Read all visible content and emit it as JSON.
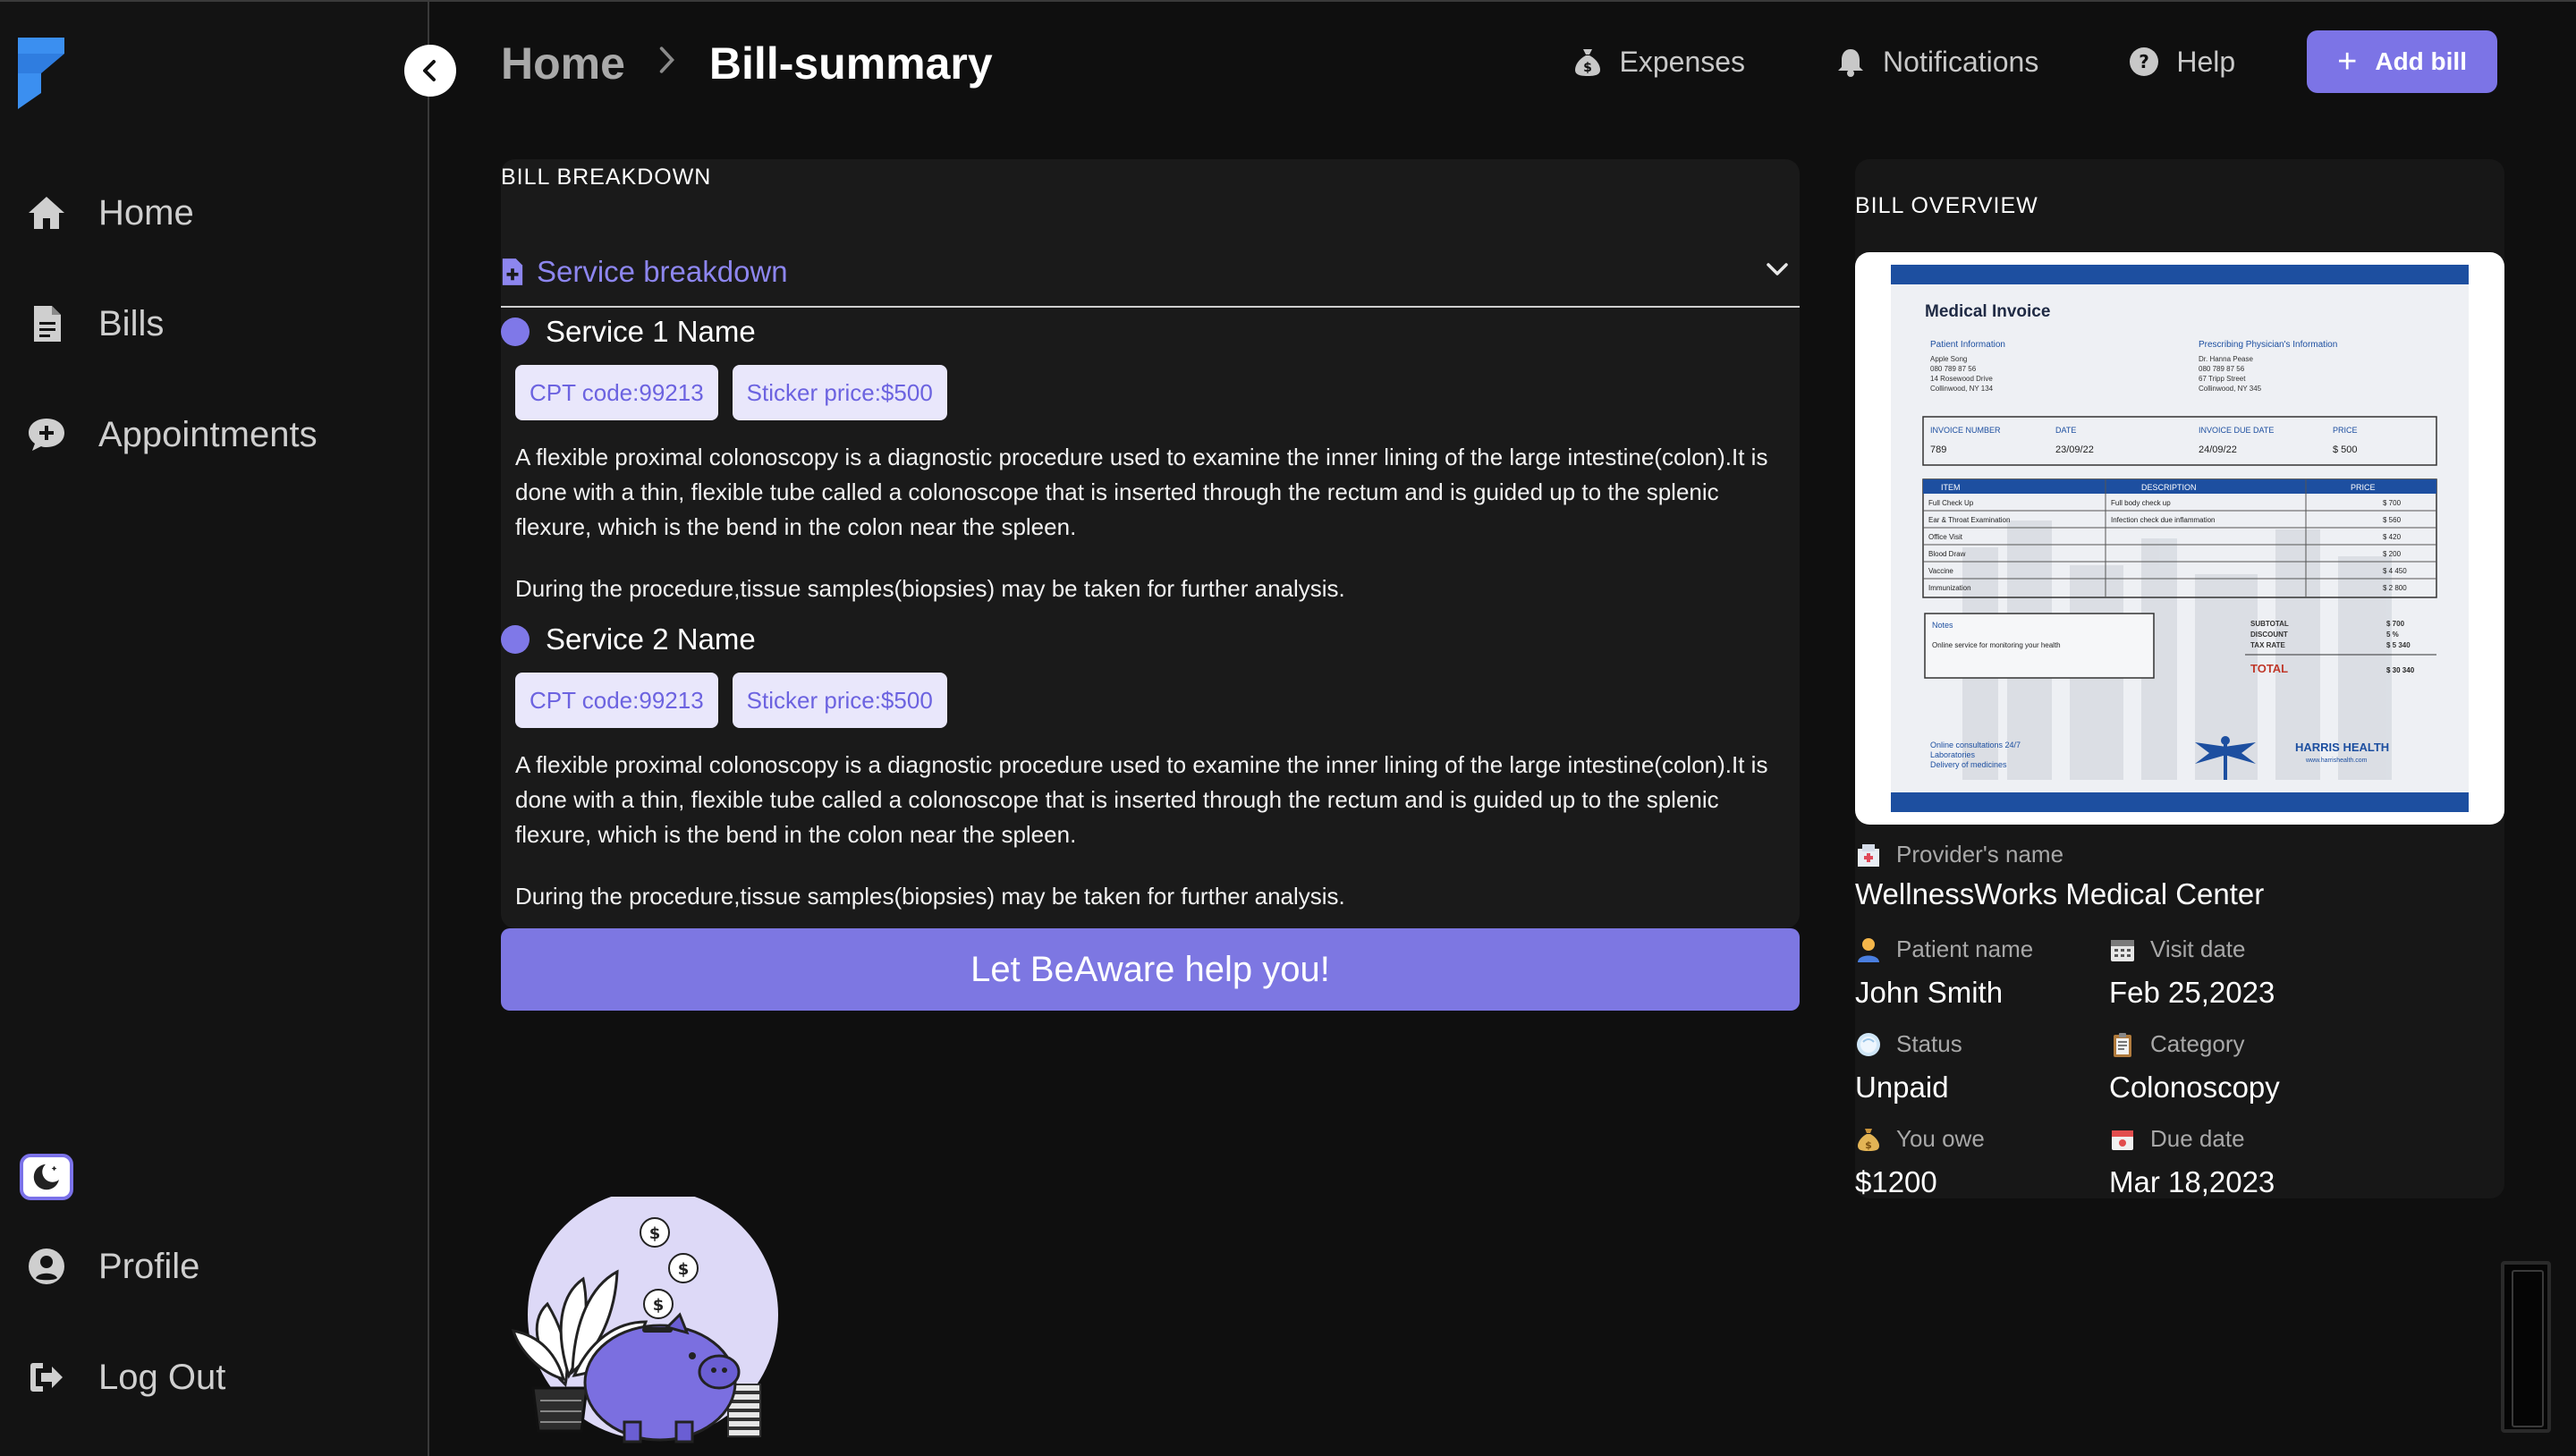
{
  "sidebar": {
    "items": [
      {
        "label": "Home",
        "icon": "home-icon"
      },
      {
        "label": "Bills",
        "icon": "file-icon"
      },
      {
        "label": "Appointments",
        "icon": "chat-plus-icon"
      }
    ],
    "bottom_items": [
      {
        "label": "Profile",
        "icon": "user-circle-icon"
      },
      {
        "label": "Log Out",
        "icon": "logout-icon"
      }
    ]
  },
  "header": {
    "breadcrumb": {
      "home": "Home",
      "separator": ">",
      "current": "Bill-summary"
    },
    "links": [
      {
        "label": "Expenses",
        "icon": "money-bag-icon"
      },
      {
        "label": "Notifications",
        "icon": "bell-icon"
      },
      {
        "label": "Help",
        "icon": "question-circle-icon"
      }
    ],
    "add_bill": {
      "plus": "+",
      "label": "Add bill"
    }
  },
  "breakdown": {
    "title": "BILL BREAKDOWN",
    "accordion_label": "Service breakdown",
    "services": [
      {
        "name": "Service 1 Name",
        "cpt": "CPT code:99213",
        "price": "Sticker price:$500",
        "description": "A flexible proximal colonoscopy is a diagnostic procedure used to examine the inner lining of the large intestine(colon).It is done with a thin, flexible tube called a colonoscope that is inserted through the rectum and is guided up to the splenic flexure, which is the bend in the colon near the spleen.",
        "note": "During the procedure,tissue samples(biopsies) may be taken for further analysis."
      },
      {
        "name": "Service 2 Name",
        "cpt": "CPT code:99213",
        "price": "Sticker price:$500",
        "description": "A flexible proximal colonoscopy is a diagnostic procedure used to examine the inner lining of the large intestine(colon).It is done with a thin, flexible tube called a colonoscope that is inserted through the rectum and is guided up to the splenic flexure, which is the bend in the colon near the spleen.",
        "note": "During the procedure,tissue samples(biopsies) may be taken for further analysis."
      }
    ],
    "cta": "Let BeAware help you!"
  },
  "overview": {
    "title": "BILL OVERVIEW",
    "invoice": {
      "heading": "Medical Invoice",
      "patient_info": "Patient Information",
      "physician_info": "Prescribing Physician's Information",
      "patient_lines": [
        "Apple Song",
        "080 789 87 56",
        "14 Rosewood Drive",
        "Collinwood, NY 134"
      ],
      "physician_lines": [
        "Dr. Hanna Pease",
        "080 789 87 56",
        "67 Tripp Street",
        "Collinwood, NY 345"
      ],
      "meta_labels": [
        "INVOICE NUMBER",
        "DATE",
        "INVOICE DUE DATE",
        "PRICE"
      ],
      "meta_values": [
        "789",
        "23/09/22",
        "24/09/22",
        "$ 500"
      ],
      "table_headers": [
        "ITEM",
        "DESCRIPTION",
        "PRICE"
      ],
      "table_rows": [
        [
          "Full Check Up",
          "Full body check up",
          "$ 700"
        ],
        [
          "Ear & Throat Examination",
          "Infection check due inflammation",
          "$ 560"
        ],
        [
          "Office Visit",
          "",
          "$ 420"
        ],
        [
          "Blood Draw",
          "",
          "$ 200"
        ],
        [
          "Vaccine",
          "",
          "$ 4 450"
        ],
        [
          "Immunization",
          "",
          "$ 2 800"
        ]
      ],
      "notes_label": "Notes",
      "notes_text": "Online service for monitoring your health",
      "totals_labels": [
        "SUBTOTAL",
        "DISCOUNT",
        "TAX RATE"
      ],
      "totals_values": [
        "$ 700",
        "5 %",
        "$ 5 340"
      ],
      "total_label": "TOTAL",
      "total_value": "$ 30 340",
      "footer_lines": [
        "Online consultations 24/7",
        "Laboratories",
        "Delivery of medicines"
      ],
      "brand": "HARRIS HEALTH",
      "brand_url": "www.harrishealth.com"
    },
    "provider_label": "Provider's name",
    "provider_value": "WellnessWorks Medical Center",
    "fields": [
      {
        "label": "Patient name",
        "value": "John Smith",
        "icon": "person-icon"
      },
      {
        "label": "Visit date",
        "value": "Feb 25,2023",
        "icon": "calendar-icon"
      },
      {
        "label": "Status",
        "value": "Unpaid",
        "icon": "status-icon"
      },
      {
        "label": "Category",
        "value": "Colonoscopy",
        "icon": "clipboard-icon"
      },
      {
        "label": "You owe",
        "value": "$1200",
        "icon": "money-bag-icon"
      },
      {
        "label": "Due date",
        "value": "Mar 18,2023",
        "icon": "due-date-icon"
      }
    ]
  },
  "colors": {
    "accent": "#7c74e6",
    "background": "#0f0f0f",
    "panel": "#1a1a1a"
  }
}
